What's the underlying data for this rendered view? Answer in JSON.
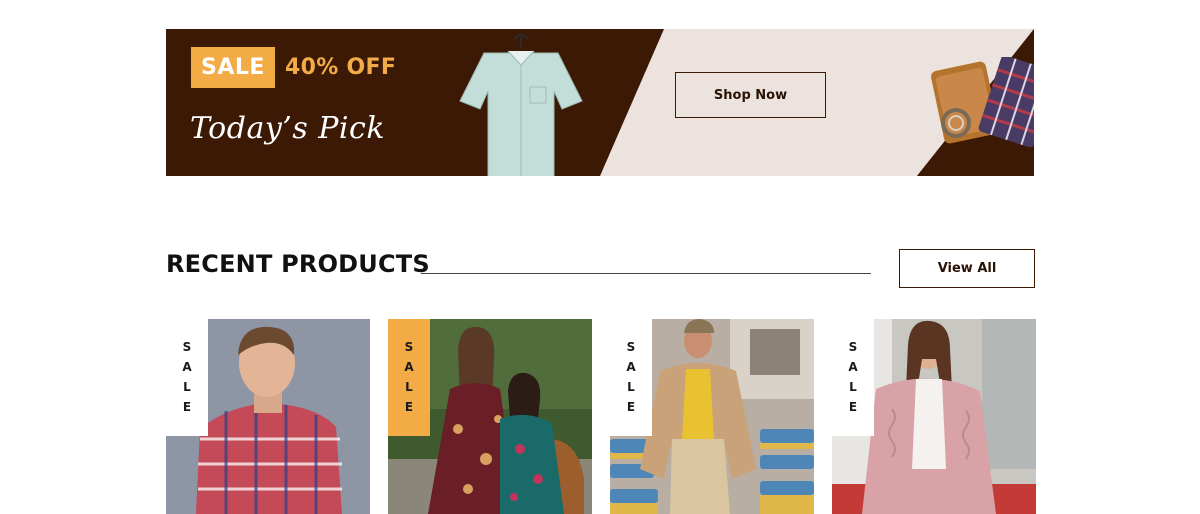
{
  "banner": {
    "sale_label": "SALE",
    "discount_text": "40% OFF",
    "tagline": "Today’s Pick",
    "shop_button": "Shop Now",
    "colors": {
      "dark": "#3c1905",
      "light": "#ece3de",
      "accent": "#f2ab45"
    }
  },
  "section": {
    "title": "RECENT PRODUCTS",
    "view_all_button": "View All"
  },
  "products": [
    {
      "tag_letters": [
        "S",
        "A",
        "L",
        "E"
      ],
      "tag_style": "white",
      "image": "man-plaid-shirt"
    },
    {
      "tag_letters": [
        "S",
        "A",
        "L",
        "E"
      ],
      "tag_style": "orange",
      "image": "two-women-floral-dresses"
    },
    {
      "tag_letters": [
        "S",
        "A",
        "L",
        "E"
      ],
      "tag_style": "white",
      "image": "man-beige-jacket-stadium"
    },
    {
      "tag_letters": [
        "S",
        "A",
        "L",
        "E"
      ],
      "tag_style": "white",
      "image": "woman-pink-cardigan"
    }
  ]
}
